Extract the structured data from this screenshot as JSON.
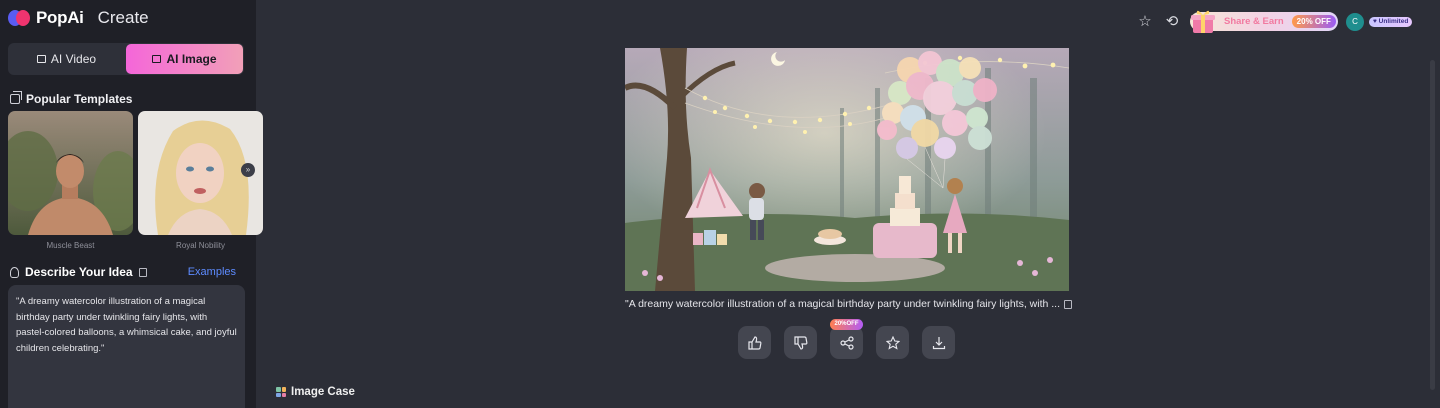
{
  "brand": {
    "name": "PopAi",
    "section": "Create"
  },
  "mode_switch": {
    "video_label": "AI Video",
    "image_label": "AI Image",
    "active": "AI Image"
  },
  "templates": {
    "title": "Popular Templates",
    "items": [
      {
        "caption": "Muscle Beast"
      },
      {
        "caption": "Royal Nobility"
      }
    ]
  },
  "describe": {
    "title": "Describe Your Idea",
    "examples_label": "Examples",
    "prompt": "\"A dreamy watercolor illustration of a magical birthday party under twinkling fairy lights, with pastel-colored balloons, a whimsical cake, and joyful children celebrating.\""
  },
  "topbar": {
    "share_label": "Share & Earn",
    "share_badge": "20% OFF",
    "avatar_initial": "C",
    "plan_badge": "Unlimited"
  },
  "result": {
    "caption": "\"A dreamy watercolor illustration of a magical birthday party under twinkling fairy lights, with ...",
    "share_badge": "20%OFF"
  },
  "image_case": {
    "title": "Image Case"
  },
  "colors": {
    "accent_pink": "#f466d9",
    "link_blue": "#5d8bff",
    "sidebar_bg": "#1f2027",
    "main_bg": "#2c2e37"
  }
}
